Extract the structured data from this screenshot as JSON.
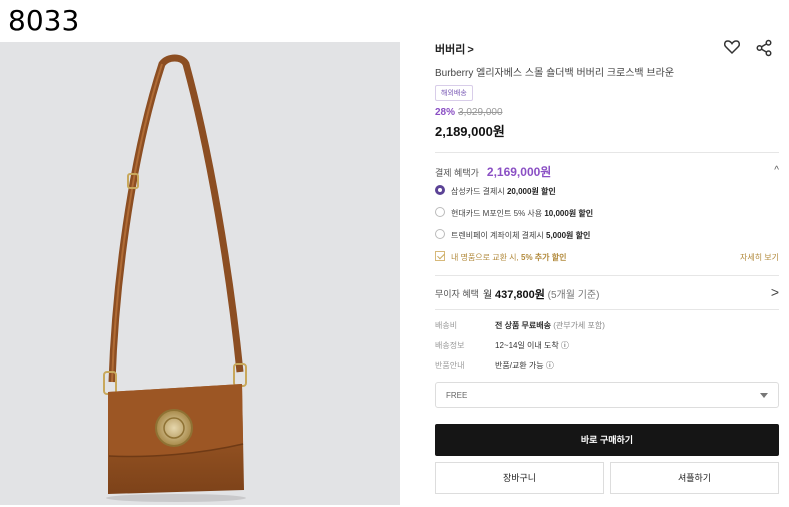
{
  "corner_label": "8033",
  "product": {
    "brand": "버버리",
    "brand_chevron": ">",
    "title": "Burberry 엘리자베스 스몰 숄더백 버버리 크로스백 브라운",
    "badge": "해외배송",
    "discount": "28%",
    "original_price": "3,029,000",
    "price": "2,189,000원",
    "icons": {
      "wishlist": "heart-icon",
      "share": "share-icon"
    }
  },
  "payment_benefit": {
    "label": "결제 혜택가",
    "price": "2,169,000원",
    "collapse_icon": "^",
    "options": [
      {
        "text": "삼성카드 결제시 ",
        "bold": "20,000원 할인",
        "selected": true
      },
      {
        "text": "현대카드 M포인트 5% 사용 ",
        "bold": "10,000원 할인",
        "selected": false
      },
      {
        "text": "트렌비페이 계좌이체 결제시 ",
        "bold": "5,000원 할인",
        "selected": false
      }
    ],
    "trade_in": {
      "text": "내 명품으로 교환 시, ",
      "bold": "5% 추가 할인",
      "link": "자세히 보기"
    }
  },
  "interest_free": {
    "label": "무이자 혜택",
    "prefix": "월 ",
    "amount": "437,800원",
    "suffix": " (5개월 기준)",
    "chevron": ">"
  },
  "shipping": {
    "rows": [
      {
        "key": "배송비",
        "value_bold": "전 상품 무료배송",
        "value_muted": " (관부가세 포함)"
      },
      {
        "key": "배송정보",
        "value_bold": "",
        "value_muted": "12~14일 이내 도착 ⓘ"
      },
      {
        "key": "반품안내",
        "value_bold": "",
        "value_muted": "반품/교환 가능 ⓘ"
      }
    ]
  },
  "size_select": {
    "value": "FREE"
  },
  "actions": {
    "buy": "바로 구매하기",
    "cart": "장바구니",
    "share": "셔플하기"
  },
  "colors": {
    "accent": "#8a4fc4",
    "radio": "#5b4396",
    "gold": "#b28a3c",
    "buy_bg": "#151515",
    "bag": "#9a5523"
  }
}
